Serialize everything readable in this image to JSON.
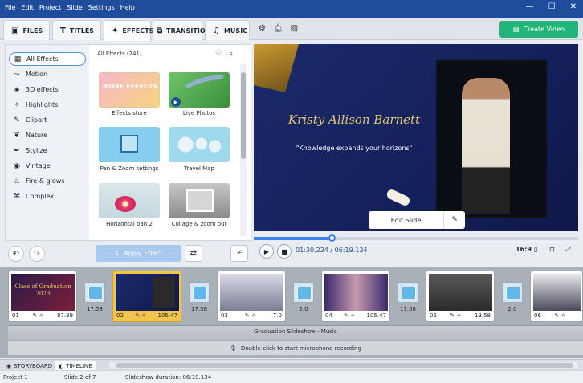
{
  "menu": [
    "File",
    "Edit",
    "Project",
    "Slide",
    "Settings",
    "Help"
  ],
  "window_controls": [
    "—",
    "☐",
    "✕"
  ],
  "tabs": [
    {
      "label": "FILES",
      "icon": "file-plus-icon"
    },
    {
      "label": "TITLES",
      "icon": "text-icon"
    },
    {
      "label": "EFFECTS",
      "icon": "sparkle-icon"
    },
    {
      "label": "TRANSITIONS",
      "icon": "transitions-icon"
    },
    {
      "label": "MUSIC",
      "icon": "music-note-icon"
    }
  ],
  "tools": [
    "gear-icon",
    "bell-icon",
    "image-icon"
  ],
  "create_button": "Create Video",
  "categories": [
    {
      "label": "All Effects",
      "icon": "grid-icon",
      "active": true
    },
    {
      "label": "Motion",
      "icon": "motion-icon"
    },
    {
      "label": "3D effects",
      "icon": "3d-icon"
    },
    {
      "label": "Highlights",
      "icon": "highlight-icon"
    },
    {
      "label": "Clipart",
      "icon": "clipart-icon"
    },
    {
      "label": "Nature",
      "icon": "leaf-icon"
    },
    {
      "label": "Stylize",
      "icon": "brush-icon"
    },
    {
      "label": "Vintage",
      "icon": "vintage-icon"
    },
    {
      "label": "Fire & glows",
      "icon": "fire-icon"
    },
    {
      "label": "Complex",
      "icon": "complex-icon"
    }
  ],
  "effects_header": "All Effects (241)",
  "effects": [
    {
      "label": "Effects store",
      "thumb_text": "MORE EFFECTS"
    },
    {
      "label": "Live Photos"
    },
    {
      "label": "Pan & Zoom settings"
    },
    {
      "label": "Travel Map"
    },
    {
      "label": "Horizontal pan 2"
    },
    {
      "label": "Collage & zoom out"
    }
  ],
  "apply_button": "Apply Effect",
  "preview": {
    "name": "Kristy Allison Barnett",
    "quote": "\"Knowledge expands your horizons\"",
    "edit_slide": "Edit Slide"
  },
  "playback": {
    "time": "01:30.224 / 06:19.134",
    "progress": 0.24,
    "aspect": "16:9"
  },
  "slides": [
    {
      "num": "01",
      "duration": "87.89",
      "thumb_text": "Class of Graduation 2023",
      "selected": false
    },
    {
      "num": "02",
      "duration": "105.47",
      "selected": true
    },
    {
      "num": "03",
      "duration": "7.0",
      "selected": false
    },
    {
      "num": "04",
      "duration": "105.47",
      "selected": false
    },
    {
      "num": "05",
      "duration": "19.58",
      "selected": false
    },
    {
      "num": "06",
      "duration": "",
      "selected": false
    }
  ],
  "transitions": [
    "17.58",
    "17.58",
    "2.0",
    "17.58",
    "2.0"
  ],
  "music_label": "Graduation Slideshow - Music",
  "mic_label": "Double-click to start microphone recording",
  "bottom_tabs": [
    "STORYBOARD",
    "TIMELINE"
  ],
  "status": {
    "project": "Project 1",
    "slide": "Slide 2 of 7",
    "duration": "Slideshow duration: 06:19.134"
  }
}
